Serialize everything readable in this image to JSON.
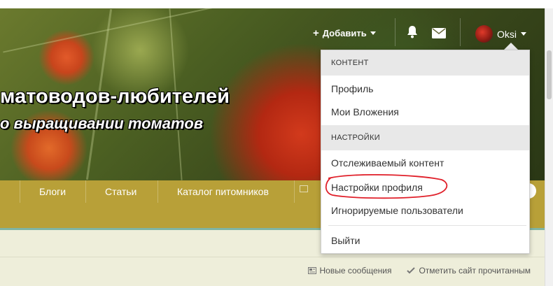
{
  "header": {
    "title": "матоводов-любителей",
    "subtitle": "о выращивании томатов",
    "add_label": "Добавить",
    "user_name": "Oksi"
  },
  "nav": {
    "items": [
      {
        "label": "Блоги"
      },
      {
        "label": "Статьи"
      },
      {
        "label": "Каталог питомников"
      }
    ]
  },
  "links": {
    "new_messages": "Новые сообщения",
    "mark_read": "Отметить сайт прочитанным"
  },
  "dropdown": {
    "section_content": "КОНТЕНТ",
    "profile": "Профиль",
    "attachments": "Мои Вложения",
    "section_settings": "НАСТРОЙКИ",
    "followed": "Отслеживаемый контент",
    "profile_settings": "Настройки профиля",
    "ignored": "Игнорируемые пользователи",
    "logout": "Выйти"
  },
  "colors": {
    "nav_bg": "#b8a038",
    "annotation": "#e0202a"
  }
}
